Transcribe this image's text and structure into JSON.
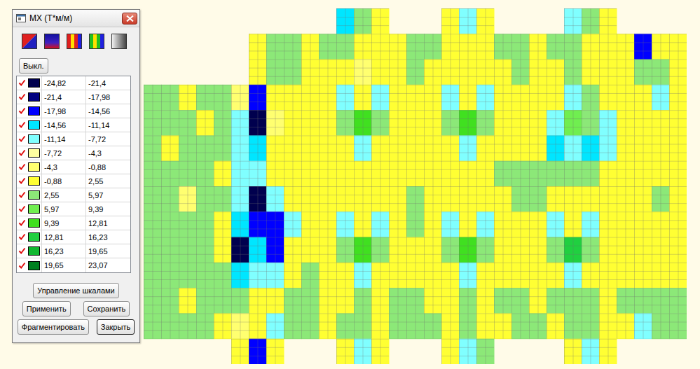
{
  "window": {
    "title": "MX (Т*м/м)"
  },
  "toggle_button": "Выкл.",
  "legend": [
    {
      "checked": true,
      "color": "#00004e",
      "from": "-24,82",
      "to": "-21,4"
    },
    {
      "checked": true,
      "color": "#000080",
      "from": "-21,4",
      "to": "-17,98"
    },
    {
      "checked": true,
      "color": "#0000ff",
      "from": "-17,98",
      "to": "-14,56"
    },
    {
      "checked": true,
      "color": "#00e6ff",
      "from": "-14,56",
      "to": "-11,14"
    },
    {
      "checked": true,
      "color": "#80ffff",
      "from": "-11,14",
      "to": "-7,72"
    },
    {
      "checked": true,
      "color": "#ffffa0",
      "from": "-7,72",
      "to": "-4,3"
    },
    {
      "checked": true,
      "color": "#ffff70",
      "from": "-4,3",
      "to": "-0,88"
    },
    {
      "checked": true,
      "color": "#ffff33",
      "from": "-0,88",
      "to": "2,55"
    },
    {
      "checked": true,
      "color": "#8ce878",
      "from": "2,55",
      "to": "5,97"
    },
    {
      "checked": true,
      "color": "#70ee50",
      "from": "5,97",
      "to": "9,39"
    },
    {
      "checked": true,
      "color": "#40e020",
      "from": "9,39",
      "to": "12,81"
    },
    {
      "checked": true,
      "color": "#20d040",
      "from": "12,81",
      "to": "16,23"
    },
    {
      "checked": true,
      "color": "#10b830",
      "from": "16,23",
      "to": "19,65"
    },
    {
      "checked": true,
      "color": "#008020",
      "from": "19,65",
      "to": "23,07"
    }
  ],
  "button_rows": [
    [
      {
        "label": "Управление шкалами",
        "focused": false
      }
    ],
    [
      {
        "label": "Применить",
        "focused": false
      },
      {
        "label": "Сохранить",
        "focused": false
      }
    ],
    [
      {
        "label": "Фрагментировать",
        "focused": false
      },
      {
        "label": "Закрыть",
        "focused": true
      }
    ]
  ],
  "plot": {
    "values": [
      [
        null,
        null,
        null,
        null,
        null,
        null,
        null,
        null,
        null,
        null,
        null,
        -13,
        4,
        0,
        null,
        null,
        null,
        0,
        -9,
        0,
        null,
        null,
        null,
        null,
        -9,
        4,
        0,
        null,
        null,
        null,
        null
      ],
      [
        null,
        null,
        null,
        null,
        null,
        null,
        0,
        4,
        4,
        0,
        4,
        4,
        0,
        0,
        0,
        4,
        4,
        0,
        0,
        0,
        4,
        4,
        0,
        4,
        4,
        0,
        0,
        0,
        -16,
        0,
        0
      ],
      [
        null,
        null,
        null,
        null,
        null,
        null,
        0,
        4,
        4,
        0,
        0,
        0,
        -3,
        0,
        0,
        4,
        0,
        0,
        0,
        0,
        0,
        4,
        0,
        0,
        4,
        0,
        0,
        0,
        4,
        4,
        0
      ],
      [
        4,
        4,
        0,
        4,
        4,
        -3,
        -16,
        0,
        0,
        0,
        0,
        -9,
        0,
        -9,
        0,
        0,
        0,
        -9,
        0,
        -9,
        0,
        0,
        0,
        0,
        -9,
        4,
        0,
        0,
        0,
        -9,
        0
      ],
      [
        4,
        4,
        4,
        0,
        4,
        -9,
        -22,
        -3,
        0,
        0,
        0,
        4,
        12,
        4,
        0,
        0,
        0,
        4,
        12,
        4,
        0,
        0,
        0,
        -9,
        8,
        4,
        -9,
        0,
        0,
        0,
        0
      ],
      [
        4,
        0,
        4,
        4,
        4,
        -9,
        -13,
        0,
        0,
        0,
        0,
        0,
        -9,
        0,
        0,
        0,
        0,
        0,
        -9,
        0,
        0,
        0,
        0,
        -13,
        -9,
        -13,
        -9,
        0,
        0,
        0,
        0
      ],
      [
        4,
        4,
        4,
        4,
        0,
        -9,
        -9,
        0,
        0,
        0,
        0,
        0,
        0,
        0,
        0,
        0,
        0,
        0,
        0,
        0,
        4,
        4,
        4,
        4,
        4,
        4,
        0,
        0,
        0,
        0,
        0
      ],
      [
        4,
        4,
        -3,
        4,
        4,
        -9,
        -22,
        -9,
        0,
        0,
        0,
        0,
        0,
        0,
        0,
        4,
        0,
        0,
        0,
        0,
        0,
        4,
        4,
        0,
        0,
        0,
        0,
        0,
        0,
        4,
        0
      ],
      [
        4,
        4,
        4,
        4,
        0,
        -13,
        -16,
        -16,
        -9,
        0,
        0,
        -9,
        0,
        -9,
        0,
        4,
        0,
        -9,
        0,
        -9,
        0,
        0,
        0,
        -9,
        0,
        -9,
        0,
        0,
        0,
        0,
        0
      ],
      [
        4,
        4,
        4,
        4,
        0,
        -22,
        -13,
        -16,
        0,
        0,
        0,
        4,
        12,
        4,
        0,
        0,
        0,
        4,
        12,
        4,
        0,
        0,
        0,
        4,
        14,
        4,
        0,
        0,
        0,
        0,
        0
      ],
      [
        4,
        4,
        4,
        4,
        4,
        -13,
        -9,
        -9,
        0,
        4,
        0,
        0,
        -9,
        0,
        0,
        0,
        0,
        0,
        -9,
        0,
        0,
        0,
        0,
        0,
        -9,
        0,
        0,
        0,
        0,
        0,
        0
      ],
      [
        4,
        4,
        0,
        4,
        4,
        4,
        0,
        0,
        4,
        4,
        0,
        0,
        4,
        0,
        4,
        4,
        0,
        0,
        4,
        0,
        4,
        4,
        0,
        4,
        4,
        4,
        0,
        4,
        4,
        4,
        4
      ],
      [
        4,
        4,
        4,
        4,
        0,
        -3,
        0,
        -9,
        4,
        4,
        0,
        4,
        4,
        0,
        4,
        4,
        4,
        0,
        4,
        0,
        0,
        4,
        4,
        0,
        4,
        4,
        0,
        0,
        -9,
        4,
        4
      ],
      [
        null,
        null,
        null,
        null,
        null,
        0,
        -16,
        0,
        null,
        null,
        null,
        0,
        -9,
        0,
        null,
        null,
        null,
        0,
        -9,
        4,
        null,
        null,
        null,
        null,
        0,
        -9,
        0,
        null,
        null,
        null,
        null
      ]
    ]
  }
}
